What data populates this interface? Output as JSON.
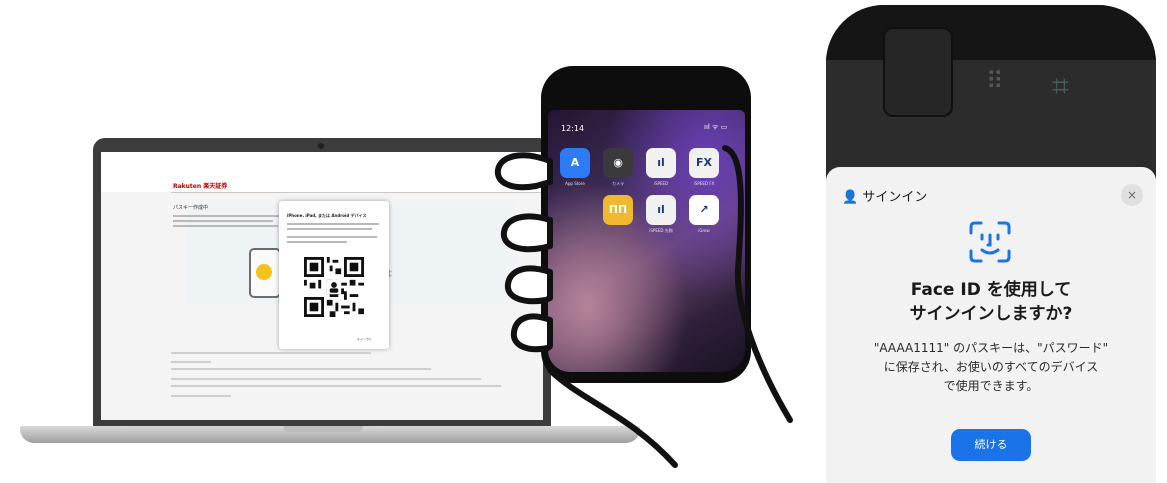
{
  "laptop": {
    "logo": "Rakuten 楽天証券",
    "page_title": "パスキー作成中",
    "dialog_title": "iPhone, iPad, または Android デバイス",
    "dialog_cancel": "キャンセル"
  },
  "phone": {
    "time": "12:14",
    "status": "ııl ᯤ ▭",
    "apps": [
      {
        "label": "App Store",
        "color": "#2d7cf6",
        "glyph": "A"
      },
      {
        "label": "カメラ",
        "color": "#3a3a3c",
        "glyph": "◉"
      },
      {
        "label": "iSPEED",
        "color": "#f1f1f1",
        "glyph": "ıl"
      },
      {
        "label": "iSPEED FX",
        "color": "#f1f1f1",
        "glyph": "FX"
      },
      {
        "label": "",
        "color": "#f0b82e",
        "glyph": "ΠΠ"
      },
      {
        "label": "iSPEED 先物",
        "color": "#f1f1f1",
        "glyph": "ıl"
      },
      {
        "label": "iGrow",
        "color": "#ffffff",
        "glyph": "↗"
      }
    ]
  },
  "faceid_sheet": {
    "title": "サインイン",
    "close": "×",
    "heading_line1": "Face ID を使用して",
    "heading_line2": "サインインしますか?",
    "body_line1": "\"AAAA1111\" のパスキーは、\"パスワード\"",
    "body_line2": "に保存され、お使いのすべてのデバイス",
    "body_line3": "で使用できます。",
    "continue_button": "続ける"
  },
  "colors": {
    "accent": "#1a73e8",
    "rakuten_red": "#bf0000",
    "sheet_bg": "#f2f2f2"
  }
}
